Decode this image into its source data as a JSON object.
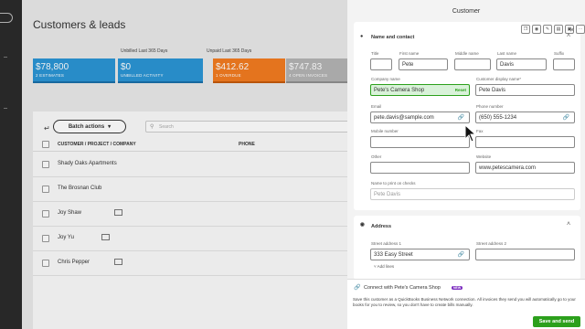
{
  "page": {
    "title": "Customers & leads"
  },
  "summary": {
    "unbilled_label": "Unbilled Last 365 Days",
    "unpaid_label": "Unpaid Last 365 Days",
    "tiles": [
      {
        "amount": "$78,800",
        "sub": "2 ESTIMATES",
        "color": "#2b95d5",
        "bar": "#1a6fa8"
      },
      {
        "amount": "$0",
        "sub": "UNBILLED ACTIVITY",
        "color": "#2b95d5",
        "bar": "#1a6fa8"
      },
      {
        "amount": "$412.62",
        "sub": "1 OVERDUE",
        "color": "#f37c20",
        "bar": "#c45a0c"
      },
      {
        "amount": "$747.83",
        "sub": "4 OPEN INVOICES",
        "color": "#b4b4b4",
        "bar": "#8f8f8f"
      }
    ]
  },
  "list": {
    "batch_label": "Batch actions",
    "search_placeholder": "Search",
    "columns": [
      "CUSTOMER / PROJECT / COMPANY",
      "PHONE"
    ],
    "rows": [
      {
        "name": "Shady Oaks Apartments",
        "mail": false
      },
      {
        "name": "The Brosnan Club",
        "mail": false
      },
      {
        "name": "Joy Shaw",
        "mail": true
      },
      {
        "name": "Joy Yu",
        "mail": true
      },
      {
        "name": "Chris Pepper",
        "mail": true
      }
    ]
  },
  "panel": {
    "title": "Customer",
    "tool_icons": [
      "copy-icon",
      "location-icon",
      "edit-icon",
      "card-icon",
      "document-icon",
      "more-icon"
    ],
    "name_section": {
      "heading": "Name and contact",
      "fields": {
        "title": {
          "label": "Title",
          "value": ""
        },
        "first": {
          "label": "First name",
          "value": "Pete"
        },
        "middle": {
          "label": "Middle name",
          "value": ""
        },
        "last": {
          "label": "Last name",
          "value": "Davis"
        },
        "suffix": {
          "label": "Suffix",
          "value": ""
        },
        "company": {
          "label": "Company name",
          "value": "Pete's Camera Shop",
          "reset": "Reset"
        },
        "display": {
          "label": "Customer display name*",
          "value": "Pete Davis"
        },
        "email": {
          "label": "Email",
          "value": "pete.davis@sample.com"
        },
        "phone": {
          "label": "Phone number",
          "value": "(650) 555-1234"
        },
        "mobile": {
          "label": "Mobile number",
          "value": ""
        },
        "fax": {
          "label": "Fax",
          "value": ""
        },
        "other": {
          "label": "Other",
          "value": ""
        },
        "website": {
          "label": "Website",
          "value": "www.petescamera.com"
        },
        "print_on_checks": {
          "label": "Name to print on checks",
          "value": "Pete Davis"
        }
      }
    },
    "address_section": {
      "heading": "Address",
      "street1": {
        "label": "Street address 1",
        "value": "333 Easy Street"
      },
      "street2": {
        "label": "Street address 2",
        "value": ""
      },
      "add_lines": "Add lines"
    },
    "connect": {
      "title": "Connect with Pete's Camera Shop",
      "badge": "NEW",
      "text": "Save this customer as a QuickBooks Business Network connection. All invoices they send you will automatically go to your books for you to review, so you don't have to create bills manually.",
      "save_label": "Save and send"
    }
  }
}
